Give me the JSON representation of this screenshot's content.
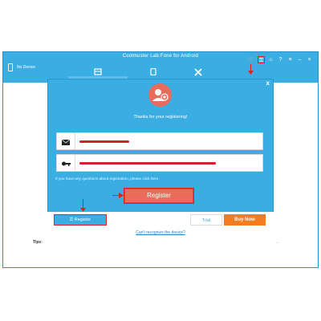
{
  "window": {
    "title": "Coolmuster Lab.Fone for Android",
    "device_label": "No Device",
    "tabs": [
      {
        "icon": "device-tab-icon"
      },
      {
        "icon": "phone-tab-icon"
      },
      {
        "icon": "tools-tab-icon"
      }
    ],
    "controls": [
      {
        "icon": "cart-icon",
        "glyph": "🛒"
      },
      {
        "icon": "key-icon",
        "glyph": "⚿"
      },
      {
        "icon": "home-icon",
        "glyph": "⌂"
      },
      {
        "icon": "help-icon",
        "glyph": "?"
      },
      {
        "icon": "menu-icon",
        "glyph": "≡"
      },
      {
        "icon": "minimize-icon",
        "glyph": "–"
      },
      {
        "icon": "close-icon",
        "glyph": "×"
      }
    ],
    "tips_label": "Tips:",
    "tips_suffix": "..."
  },
  "dialog": {
    "close_glyph": "x",
    "thanks_text": "Thanks for your registering!",
    "email_field": {
      "icon": "envelope-icon",
      "value_redacted": true
    },
    "code_field": {
      "icon": "key-icon",
      "value_redacted": true
    },
    "note_text": "If you have any questions about registration, please click here.",
    "register_button": "Register"
  },
  "footer": {
    "register_label": "Register",
    "trial_label": "Trial",
    "buy_label": "Buy Now",
    "cant_recognize": "Can't recognize the device?"
  },
  "colors": {
    "titlebar": "#3aaee3",
    "accent_red": "#e86b5b",
    "annotation_red": "#e02020",
    "buy_orange": "#f47b20"
  }
}
